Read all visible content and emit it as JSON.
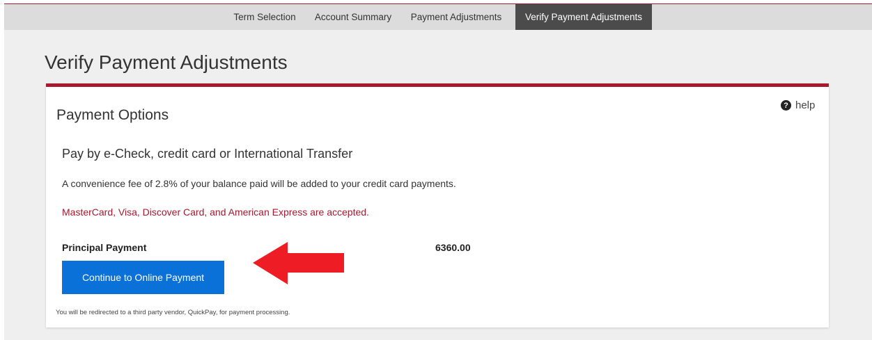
{
  "nav": {
    "items": [
      {
        "label": "Term Selection"
      },
      {
        "label": "Account Summary"
      },
      {
        "label": "Payment Adjustments"
      },
      {
        "label": "Verify Payment Adjustments"
      }
    ]
  },
  "page": {
    "title": "Verify Payment Adjustments"
  },
  "card": {
    "section_title": "Payment Options",
    "help_label": "help",
    "subtitle": "Pay by e-Check, credit card or International Transfer",
    "fee_note": "A convenience fee of 2.8% of your balance paid will be added to your credit card payments.",
    "cards_note": "MasterCard, Visa, Discover Card, and American Express are accepted.",
    "payment_label": "Principal Payment",
    "payment_amount": "6360.00",
    "continue_label": "Continue to Online Payment",
    "redirect_note": "You will be redirected to a third party vendor, QuickPay, for payment processing."
  },
  "colors": {
    "accent": "#a6192e",
    "button": "#0a71d8",
    "nav_active": "#4b4b4b",
    "arrow": "#ee1c24"
  },
  "icons": {
    "help": "question-circle-icon",
    "annotation": "arrow-left-icon"
  }
}
